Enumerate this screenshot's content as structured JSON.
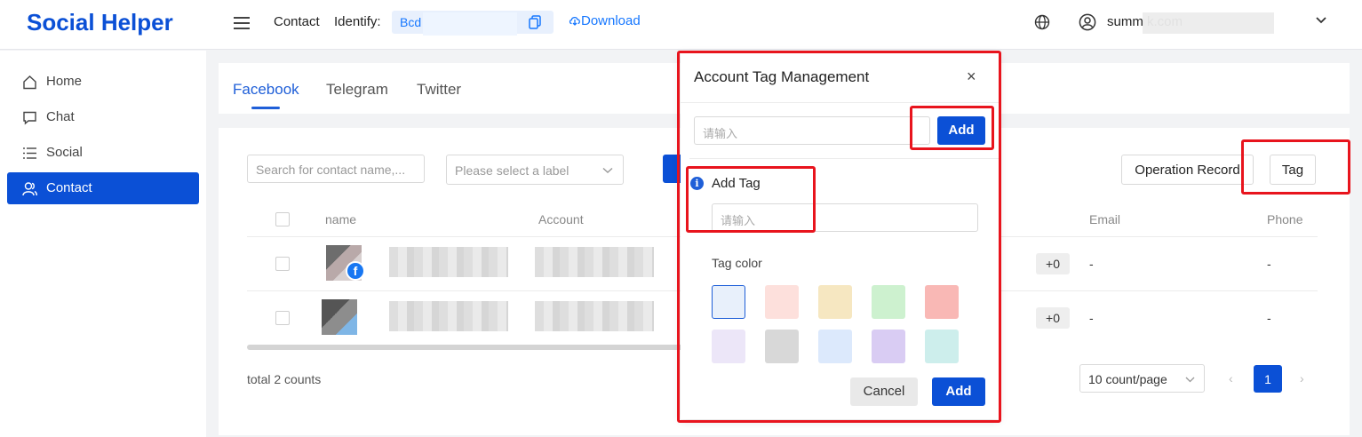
{
  "app": {
    "title": "Social Helper"
  },
  "header": {
    "contact_label": "Contact",
    "identify_label": "Identify:",
    "identify_value": "Bcd",
    "download_label": "Download",
    "user_email": "summ                    k.com"
  },
  "sidebar": {
    "items": [
      {
        "label": "Home",
        "icon": "home-icon",
        "active": false
      },
      {
        "label": "Chat",
        "icon": "chat-icon",
        "active": false
      },
      {
        "label": "Social",
        "icon": "list-icon",
        "active": false
      },
      {
        "label": "Contact",
        "icon": "contact-icon",
        "active": true
      }
    ]
  },
  "tabs": [
    {
      "label": "Facebook",
      "active": true
    },
    {
      "label": "Telegram",
      "active": false
    },
    {
      "label": "Twitter",
      "active": false
    }
  ],
  "toolbar": {
    "search_placeholder": "Search for contact name,...",
    "label_select_placeholder": "Please select a label",
    "operation_record_label": "Operation Record",
    "tag_label": "Tag"
  },
  "table": {
    "columns": [
      "name",
      "Account",
      "Email",
      "Phone"
    ],
    "rows": [
      {
        "tags_count": "+0",
        "email": "-",
        "phone": "-"
      },
      {
        "tags_count": "+0",
        "email": "-",
        "phone": "-"
      }
    ]
  },
  "footer": {
    "total": "total 2 counts",
    "page_size": "10 count/page",
    "prev_arrow": "‹",
    "next_arrow": "›",
    "current_page": "1"
  },
  "modal": {
    "title": "Account Tag Management",
    "close_icon": "×",
    "input_placeholder": "请输入",
    "add_label": "Add",
    "popover": {
      "title": "Add Tag",
      "input_placeholder": "请输入",
      "color_label": "Tag color",
      "colors": [
        "#e8f0fb",
        "#fde0dc",
        "#f6e7c1",
        "#cdf1cf",
        "#f9b8b5",
        "#ece6f8",
        "#d8d8d8",
        "#dce9fc",
        "#d9ccf3",
        "#cdeeec"
      ],
      "selected_color_index": 0,
      "cancel_label": "Cancel",
      "add_label": "Add"
    }
  },
  "colors": {
    "brand": "#0b50d6",
    "link": "#1677ff",
    "highlight": "#e8141d"
  }
}
